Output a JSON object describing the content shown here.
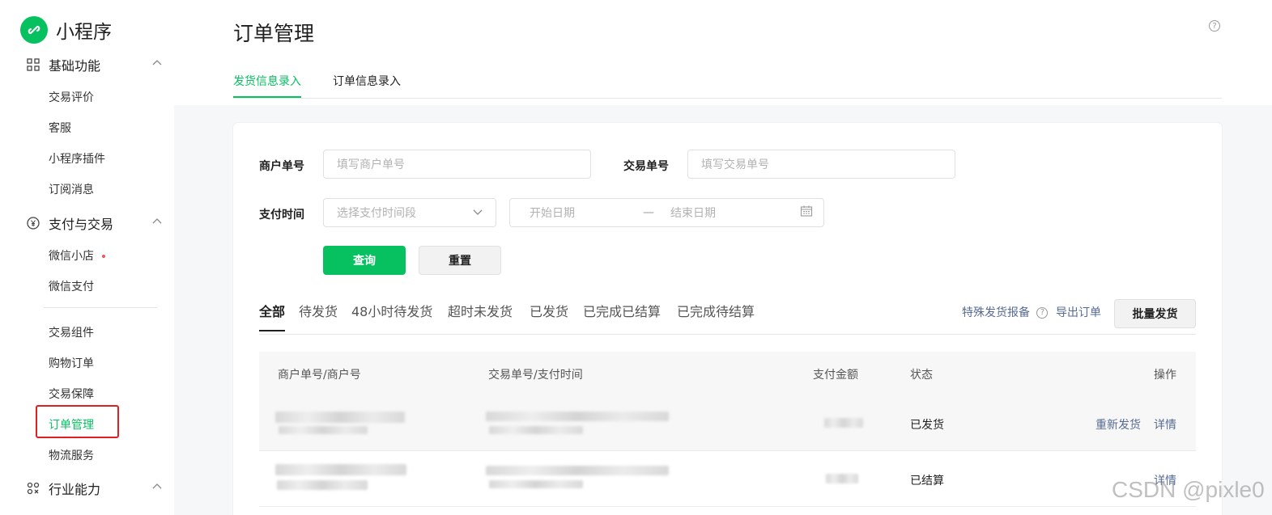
{
  "app": {
    "logo_text": "小程序"
  },
  "sidebar": {
    "groups": [
      {
        "label": "基础功能",
        "items": [
          "交易评价",
          "客服",
          "小程序插件",
          "订阅消息"
        ]
      },
      {
        "label": "支付与交易",
        "items": [
          "微信小店",
          "微信支付",
          "交易组件",
          "购物订单",
          "交易保障",
          "订单管理",
          "物流服务"
        ]
      },
      {
        "label": "行业能力",
        "items": []
      }
    ]
  },
  "page": {
    "title": "订单管理",
    "help": "?",
    "tabs": [
      "发货信息录入",
      "订单信息录入"
    ]
  },
  "filters": {
    "merchant_no_label": "商户单号",
    "merchant_no_placeholder": "填写商户单号",
    "trade_no_label": "交易单号",
    "trade_no_placeholder": "填写交易单号",
    "pay_time_label": "支付时间",
    "pay_time_select": "选择支付时间段",
    "start_date": "开始日期",
    "date_sep": "—",
    "end_date": "结束日期",
    "query_btn": "查询",
    "reset_btn": "重置"
  },
  "order_tabs": [
    "全部",
    "待发货",
    "48小时待发货",
    "超时未发货",
    "已发货",
    "已完成已结算",
    "已完成待结算"
  ],
  "actions": {
    "special_report": "特殊发货报备",
    "export": "导出订单",
    "batch_ship": "批量发货"
  },
  "table": {
    "headers": [
      "商户单号/商户号",
      "交易单号/支付时间",
      "支付金额",
      "状态",
      "操作"
    ],
    "rows": [
      {
        "status": "已发货",
        "ops": [
          "重新发货",
          "详情"
        ]
      },
      {
        "status": "已结算",
        "ops": [
          "详情"
        ]
      }
    ]
  },
  "watermark": "CSDN @pixle0",
  "colors": {
    "accent": "#07c160",
    "link": "#576b95",
    "highlight_box": "#e02020"
  }
}
